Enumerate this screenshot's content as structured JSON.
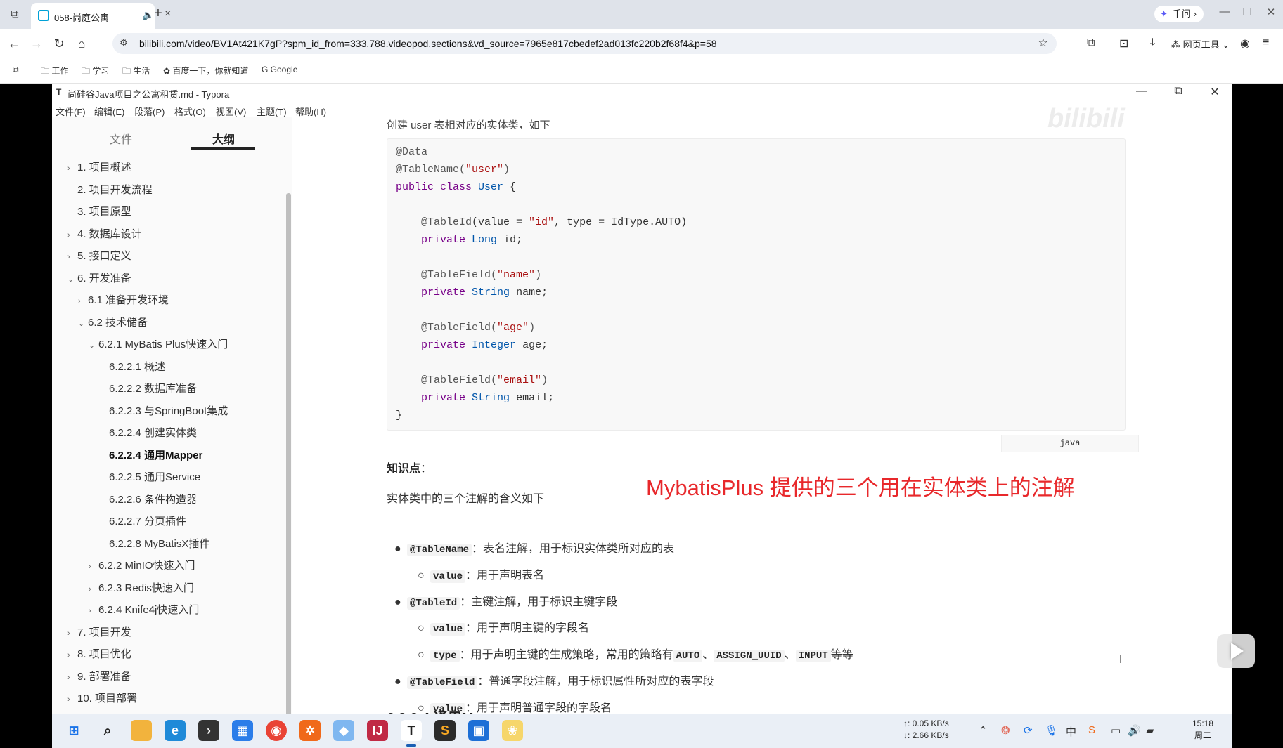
{
  "browser": {
    "tab_title": "058-尚庭公寓",
    "address": "bilibili.com/video/BV1At421K7gP?spm_id_from=333.788.videopod.sections&vd_source=7965e817cbedef2ad013fc220b2f68f4&p=58",
    "qianwen_label": "千问",
    "web_tools_label": "网页工具",
    "bookmarks": [
      "工作",
      "学习",
      "生活",
      "百度一下，你就知道",
      "Google"
    ]
  },
  "typora": {
    "window_title": "尚硅谷Java项目之公寓租赁.md - Typora",
    "menus": [
      "文件(F)",
      "编辑(E)",
      "段落(P)",
      "格式(O)",
      "视图(V)",
      "主题(T)",
      "帮助(H)"
    ],
    "sidebar_tabs": {
      "files": "文件",
      "outline": "大纲"
    },
    "outline": [
      {
        "label": "1. 项目概述",
        "chev": "›"
      },
      {
        "label": "2. 项目开发流程",
        "chev": ""
      },
      {
        "label": "3. 项目原型",
        "chev": ""
      },
      {
        "label": "4. 数据库设计",
        "chev": "›"
      },
      {
        "label": "5. 接口定义",
        "chev": "›"
      },
      {
        "label": "6. 开发准备",
        "chev": "⌄"
      },
      {
        "label": "6.1 准备开发环境",
        "chev": "›"
      },
      {
        "label": "6.2 技术储备",
        "chev": "⌄"
      },
      {
        "label": "6.2.1 MyBatis Plus快速入门",
        "chev": "⌄"
      },
      {
        "label": "6.2.2.1 概述",
        "chev": ""
      },
      {
        "label": "6.2.2.2 数据库准备",
        "chev": ""
      },
      {
        "label": "6.2.2.3 与SpringBoot集成",
        "chev": ""
      },
      {
        "label": "6.2.2.4 创建实体类",
        "chev": ""
      },
      {
        "label": "6.2.2.4 通用Mapper",
        "chev": ""
      },
      {
        "label": "6.2.2.5 通用Service",
        "chev": ""
      },
      {
        "label": "6.2.2.6 条件构造器",
        "chev": ""
      },
      {
        "label": "6.2.2.7 分页插件",
        "chev": ""
      },
      {
        "label": "6.2.2.8 MyBatisX插件",
        "chev": ""
      },
      {
        "label": "6.2.2 MinIO快速入门",
        "chev": "›"
      },
      {
        "label": "6.2.3 Redis快速入门",
        "chev": "›"
      },
      {
        "label": "6.2.4 Knife4j快速入门",
        "chev": "›"
      },
      {
        "label": "7. 项目开发",
        "chev": "›"
      },
      {
        "label": "8. 项目优化",
        "chev": "›"
      },
      {
        "label": "9. 部署准备",
        "chev": "›"
      },
      {
        "label": "10. 项目部署",
        "chev": "›"
      }
    ],
    "cut_line": "创建 user 表相对应的实体类，如下",
    "code_lang": "java",
    "knowledge_label": "知识点",
    "knowledge_colon": "：",
    "desc": "实体类中的三个注解的含义如下",
    "overlay": "MybatisPlus 提供的三个用在实体类上的注解",
    "bullets": {
      "b1_code": "@TableName",
      "b1_text": "：表名注解，用于标识实体类所对应的表",
      "b1a_code": "value",
      "b1a_text": "：用于声明表名",
      "b2_code": "@TableId",
      "b2_text": "：主键注解，用于标识主键字段",
      "b2a_code": "value",
      "b2a_text": "：用于声明主键的字段名",
      "b2b_code": "type",
      "b2b_text": "：用于声明主键的生成策略，常用的策略有",
      "b2b_c1": "AUTO",
      "b2b_sep1": "、",
      "b2b_c2": "ASSIGN_UUID",
      "b2b_sep2": "、",
      "b2b_c3": "INPUT",
      "b2b_tail": "等等",
      "b3_code": "@TableField",
      "b3_text": "：普通字段注解，用于标识属性所对应的表字段",
      "b3a_code": "value",
      "b3a_text": "：用于声明普通字段的字段名"
    },
    "next_heading": "6.2.2.4 通用Mapper"
  },
  "taskbar": {
    "net_up": "↑: 0.05 KB/s",
    "net_down": "↓: 2.66 KB/s",
    "time": "15:18",
    "day": "周二"
  },
  "colors": {
    "overlay": "#e8282b",
    "accent": "#1a5fb4"
  }
}
